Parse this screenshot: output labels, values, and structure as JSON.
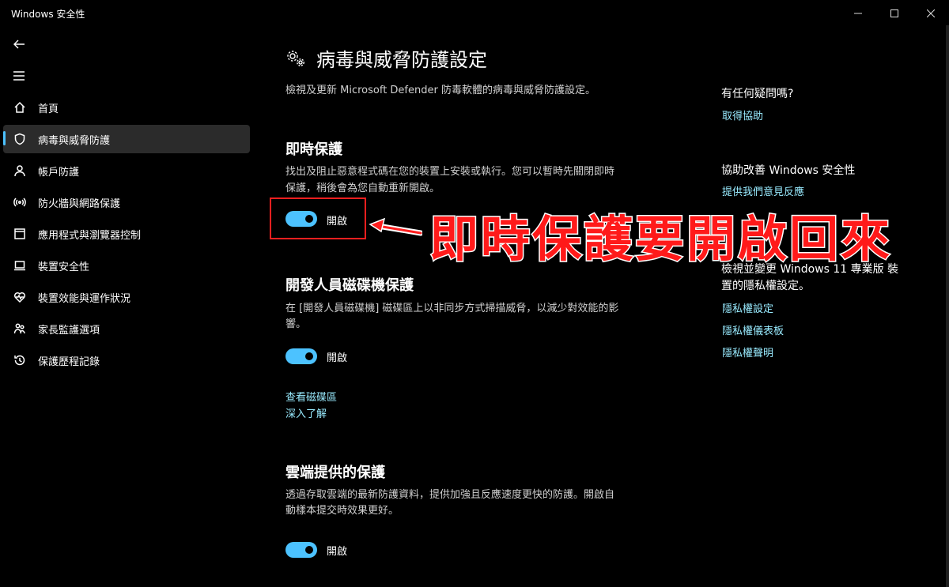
{
  "window": {
    "title": "Windows 安全性"
  },
  "sidebar": {
    "items": [
      {
        "label": "首頁",
        "icon": "home-icon"
      },
      {
        "label": "病毒與威脅防護",
        "icon": "shield-icon",
        "active": true
      },
      {
        "label": "帳戶防護",
        "icon": "person-icon"
      },
      {
        "label": "防火牆與網路保護",
        "icon": "wireless-icon"
      },
      {
        "label": "應用程式與瀏覽器控制",
        "icon": "app-window-icon"
      },
      {
        "label": "裝置安全性",
        "icon": "laptop-icon"
      },
      {
        "label": "裝置效能與運作狀況",
        "icon": "heart-pulse-icon"
      },
      {
        "label": "家長監護選項",
        "icon": "family-icon"
      },
      {
        "label": "保護歷程記錄",
        "icon": "history-icon"
      }
    ]
  },
  "main": {
    "title": "病毒與威脅防護設定",
    "description": "檢視及更新 Microsoft Defender 防毒軟體的病毒與威脅防護設定。",
    "realtime": {
      "title": "即時保護",
      "desc_line1": "找出及阻止惡意程式碼在您的裝置上安裝或執行。您可以暫時先關閉即時",
      "desc_line2": "保護，稍後會為您自動重新開啟。",
      "toggle_label": "開啟",
      "enabled": true
    },
    "devdrive": {
      "title": "開發人員磁碟機保護",
      "desc_line1": "在 [開發人員磁碟機] 磁碟區上以非同步方式掃描威脅，以減少對效能的影",
      "desc_line2": "響。",
      "toggle_label": "開啟",
      "enabled": true,
      "link_view": "查看磁碟區",
      "link_learn": "深入了解"
    },
    "cloud": {
      "title": "雲端提供的保護",
      "desc_line1": "透過存取雲端的最新防護資料，提供加強且反應速度更快的防護。開啟自",
      "desc_line2": "動樣本提交時效果更好。",
      "toggle_label": "開啟",
      "enabled": true
    }
  },
  "right": {
    "help_title": "有任何疑問嗎?",
    "help_link": "取得協助",
    "improve_title": "協助改善 Windows 安全性",
    "improve_link": "提供我們意見反應",
    "privacy_line1": "檢視並變更 Windows 11 專業版 裝",
    "privacy_line2": "置的隱私權設定。",
    "privacy_links": [
      "隱私權設定",
      "隱私權儀表板",
      "隱私權聲明"
    ]
  },
  "annotation": {
    "text": "即時保護要開啟回來",
    "color": "#ff1a1a"
  },
  "colors": {
    "accent": "#4cc2ff",
    "link": "#99ebff",
    "background": "#000000"
  }
}
